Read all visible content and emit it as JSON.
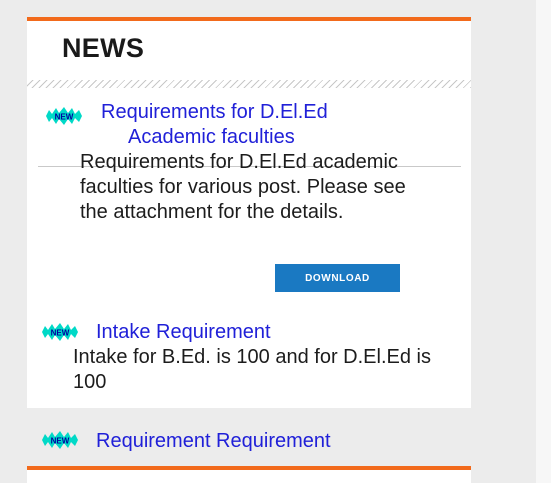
{
  "panel": {
    "title": "NEWS"
  },
  "colors": {
    "accent": "#f26a1b",
    "link": "#2020d8",
    "button": "#1a79c2",
    "badge_fill": "#00d9c7",
    "badge_text": "#0000a0"
  },
  "news": {
    "badge_label": "NEW",
    "items": [
      {
        "title_line1": "Requirements for D.El.Ed",
        "title_line2": "Academic faculties",
        "description": "Requirements for D.El.Ed academic faculties for various post. Please see the attachment for the details.",
        "button_label": "DOWNLOAD"
      },
      {
        "title": "Intake Requirement",
        "description": "Intake for B.Ed. is 100 and for D.El.Ed is 100"
      },
      {
        "title": "Requirement Requirement"
      }
    ]
  }
}
